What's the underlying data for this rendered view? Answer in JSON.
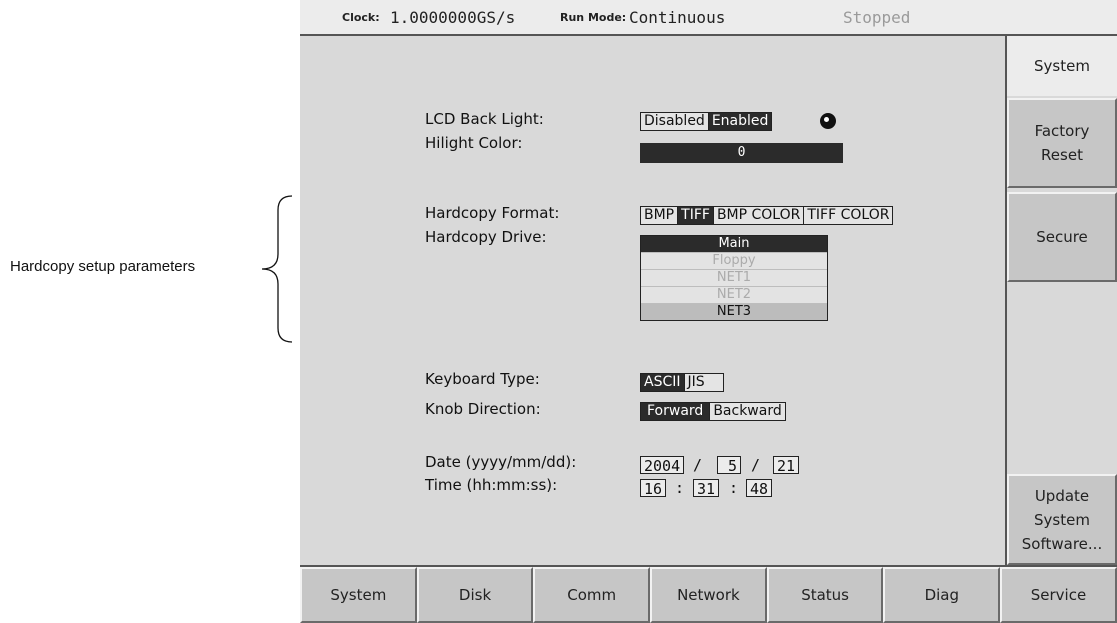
{
  "annotation": {
    "label": "Hardcopy setup parameters"
  },
  "status": {
    "clock_label": "Clock:",
    "clock_value": "1.0000000GS/s",
    "run_mode_label": "Run Mode:",
    "run_mode_value": "Continuous",
    "state": "Stopped"
  },
  "settings": {
    "lcd_backlight": {
      "label": "LCD Back Light:",
      "options": [
        "Disabled",
        "Enabled"
      ],
      "selected": "Enabled"
    },
    "hilight_color": {
      "label": "Hilight Color:",
      "value": "0"
    },
    "hardcopy_format": {
      "label": "Hardcopy Format:",
      "options": [
        "BMP",
        "TIFF",
        "BMP COLOR",
        "TIFF COLOR"
      ],
      "selected": "TIFF"
    },
    "hardcopy_drive": {
      "label": "Hardcopy Drive:",
      "options": [
        "Main",
        "Floppy",
        "NET1",
        "NET2",
        "NET3"
      ],
      "selected": "Main"
    },
    "keyboard_type": {
      "label": "Keyboard Type:",
      "options": [
        "ASCII",
        "JIS"
      ],
      "selected": "ASCII"
    },
    "knob_direction": {
      "label": "Knob Direction:",
      "options": [
        "Forward",
        "Backward"
      ],
      "selected": "Forward"
    },
    "date": {
      "label": "Date (yyyy/mm/dd):",
      "year": "2004",
      "month": "5",
      "day": "21",
      "sep": "/"
    },
    "time": {
      "label": "Time (hh:mm:ss):",
      "hour": "16",
      "minute": "31",
      "second": "48",
      "sep": ":"
    }
  },
  "side_menu": {
    "title": "System",
    "factory_reset": [
      "Factory",
      "Reset"
    ],
    "secure": "Secure",
    "update": [
      "Update",
      "System",
      "Software..."
    ]
  },
  "bottom_tabs": [
    "System",
    "Disk",
    "Comm",
    "Network",
    "Status",
    "Diag",
    "Service"
  ],
  "colors": {
    "panel": "#d9d9d9",
    "selected": "#2b2b2b",
    "button": "#c6c6c6"
  }
}
